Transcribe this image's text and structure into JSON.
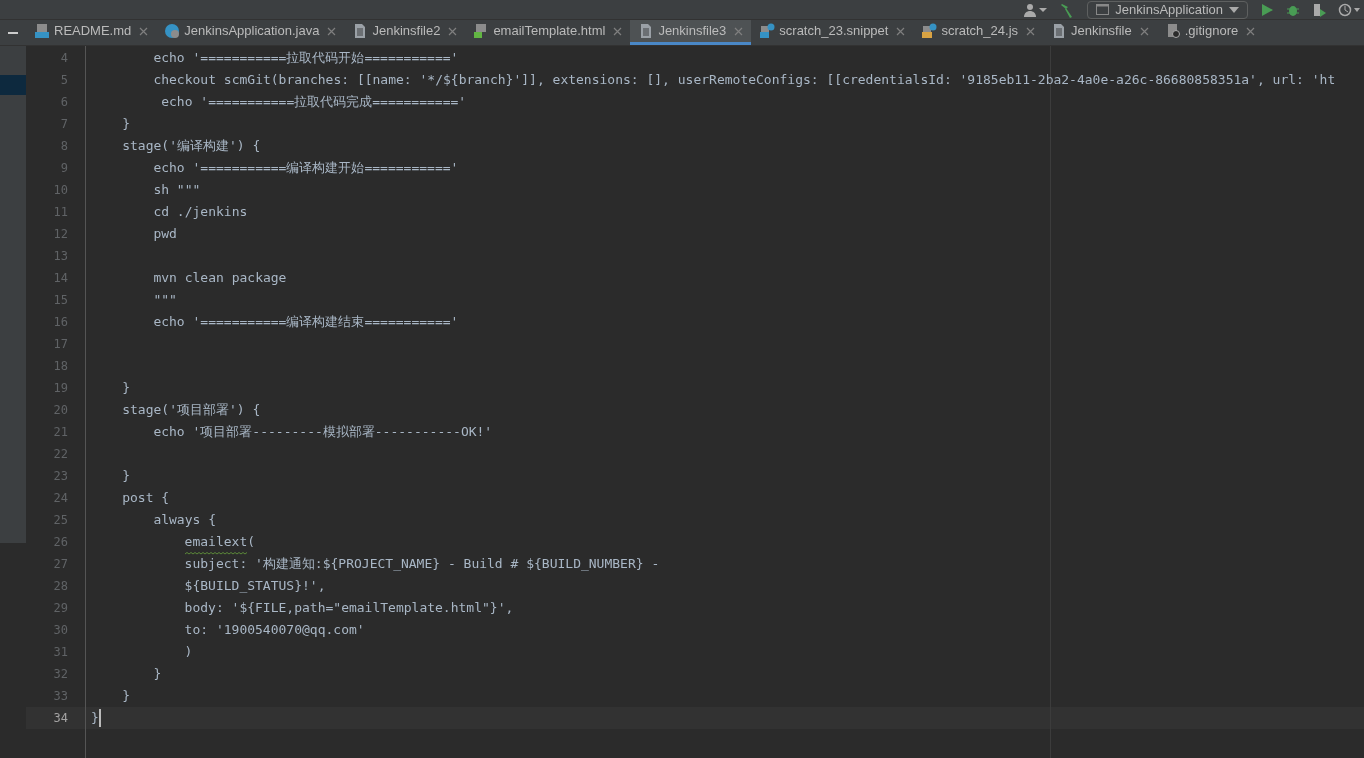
{
  "toolbar": {
    "run_config": "JenkinsApplication"
  },
  "tabs": [
    {
      "label": "README.md",
      "kind": "markdown",
      "selected": false
    },
    {
      "label": "JenkinsApplication.java",
      "kind": "java",
      "selected": false
    },
    {
      "label": "Jenkinsfile2",
      "kind": "text",
      "selected": false
    },
    {
      "label": "emailTemplate.html",
      "kind": "html",
      "selected": false
    },
    {
      "label": "Jenkinsfile3",
      "kind": "text",
      "selected": true
    },
    {
      "label": "scratch_23.snippet",
      "kind": "scratch",
      "selected": false
    },
    {
      "label": "scratch_24.js",
      "kind": "js",
      "selected": false
    },
    {
      "label": "Jenkinsfile",
      "kind": "text",
      "selected": false
    },
    {
      "label": ".gitignore",
      "kind": "ignore",
      "selected": false
    }
  ],
  "editor": {
    "lines": [
      {
        "number": "4",
        "text": "        echo '===========拉取代码开始==========='",
        "current": false,
        "flagged": false
      },
      {
        "number": "5",
        "text": "        checkout scmGit(branches: [[name: '*/${branch}']], extensions: [], userRemoteConfigs: [[credentialsId: '9185eb11-2ba2-4a0e-a26c-86680858351a', url: 'ht",
        "current": false,
        "flagged": false
      },
      {
        "number": "6",
        "text": "         echo '===========拉取代码完成==========='",
        "current": false,
        "flagged": false
      },
      {
        "number": "7",
        "text": "    }",
        "current": false,
        "flagged": false
      },
      {
        "number": "8",
        "text": "    stage('编译构建') {",
        "current": false,
        "flagged": false
      },
      {
        "number": "9",
        "text": "        echo '===========编译构建开始==========='",
        "current": false,
        "flagged": false
      },
      {
        "number": "10",
        "text": "        sh \"\"\"",
        "current": false,
        "flagged": false
      },
      {
        "number": "11",
        "text": "        cd ./jenkins",
        "current": false,
        "flagged": false
      },
      {
        "number": "12",
        "text": "        pwd",
        "current": false,
        "flagged": false
      },
      {
        "number": "13",
        "current": false
      },
      {
        "number": "14",
        "text": "        mvn clean package",
        "current": false,
        "flagged": false
      },
      {
        "number": "15",
        "text": "        \"\"\"",
        "current": false,
        "flagged": false
      },
      {
        "number": "16",
        "text": "        echo '===========编译构建结束==========='",
        "current": false,
        "flagged": false
      },
      {
        "number": "17",
        "current": false
      },
      {
        "number": "18",
        "current": false
      },
      {
        "number": "19",
        "text": "    }",
        "current": false,
        "flagged": false
      },
      {
        "number": "20",
        "text": "    stage('项目部署') {",
        "current": false,
        "flagged": false
      },
      {
        "number": "21",
        "text": "        echo '项目部署---------模拟部署-----------OK!'",
        "current": false,
        "flagged": false
      },
      {
        "number": "22",
        "current": false
      },
      {
        "number": "23",
        "text": "    }",
        "current": false,
        "flagged": false
      },
      {
        "number": "24",
        "text": "    post {",
        "current": false,
        "flagged": false
      },
      {
        "number": "25",
        "text": "        always {",
        "current": false,
        "flagged": false
      },
      {
        "number": "26",
        "text": "            emailext(",
        "current": false,
        "flagged": true
      },
      {
        "number": "27",
        "text": "            subject: '构建通知:${PROJECT_NAME} - Build # ${BUILD_NUMBER} -",
        "current": false,
        "flagged": false
      },
      {
        "number": "28",
        "text": "            ${BUILD_STATUS}!',",
        "current": false,
        "flagged": false
      },
      {
        "number": "29",
        "text": "            body: '${FILE,path=\"emailTemplate.html\"}',",
        "current": false,
        "flagged": false
      },
      {
        "number": "30",
        "text": "            to: '1900540070@qq.com'",
        "current": false,
        "flagged": false
      },
      {
        "number": "31",
        "text": "            )",
        "current": false,
        "flagged": false
      },
      {
        "number": "32",
        "text": "        }",
        "current": false,
        "flagged": false
      },
      {
        "number": "33",
        "text": "    }",
        "current": false,
        "flagged": false
      },
      {
        "number": "34",
        "text": "}",
        "current": true,
        "flagged": false
      }
    ]
  }
}
